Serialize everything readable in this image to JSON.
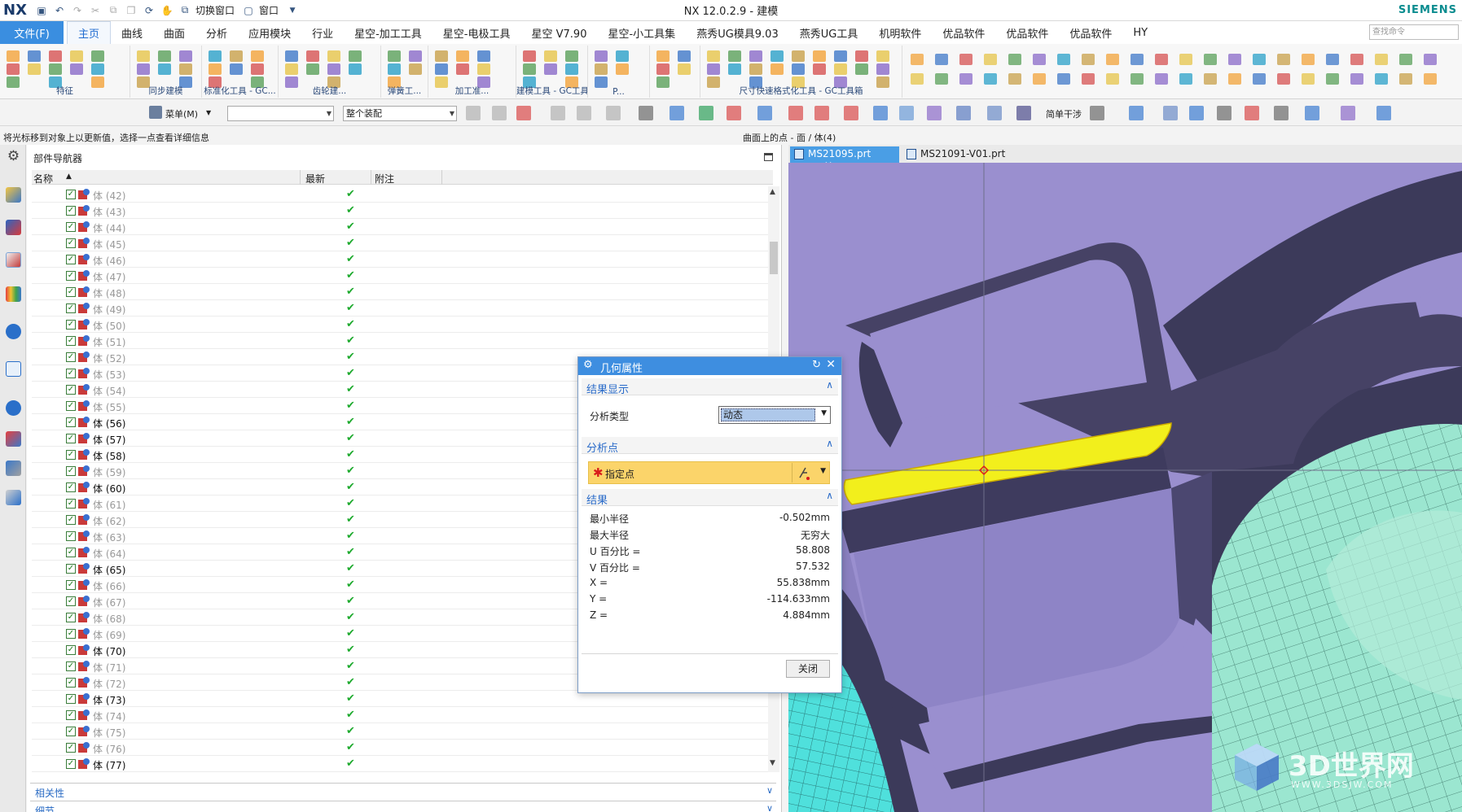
{
  "titlebar": {
    "logo": "NX",
    "switch_window": "切换窗口",
    "window_menu": "窗口",
    "title": "NX 12.0.2.9 - 建模",
    "brand": "SIEMENS"
  },
  "ribbon": {
    "file_tab": "文件(F)",
    "tabs": [
      "主页",
      "曲线",
      "曲面",
      "分析",
      "应用模块",
      "行业",
      "星空-加工工具",
      "星空-电极工具",
      "星空 V7.90",
      "星空-小工具集",
      "燕秀UG模具9.03",
      "燕秀UG工具",
      "机明软件",
      "优品软件",
      "优品软件",
      "优品软件",
      "HY"
    ],
    "active_tab": "主页",
    "search_placeholder": "查找命令",
    "groups": [
      "特征",
      "同步建模",
      "标准化工具 - GC...",
      "齿轮建...",
      "弹簧工...",
      "加工准...",
      "建模工具 - GC工具...",
      "P...",
      "尺寸快速格式化工具 - GC工具箱"
    ]
  },
  "toolbar2": {
    "menu_label": "菜单(M)",
    "filter_value": "",
    "assembly_value": "整个装配",
    "simple_interference": "简单干涉"
  },
  "status": {
    "left": "将光标移到对象上以更新值，选择一点查看详细信息",
    "right": "曲面上的点 - 面 / 体(4)"
  },
  "navigator": {
    "title": "部件导航器",
    "columns": [
      "名称",
      "最新",
      "附注"
    ],
    "rows": [
      {
        "name": "体 (42)",
        "active": false
      },
      {
        "name": "体 (43)",
        "active": false
      },
      {
        "name": "体 (44)",
        "active": false
      },
      {
        "name": "体 (45)",
        "active": false
      },
      {
        "name": "体 (46)",
        "active": false
      },
      {
        "name": "体 (47)",
        "active": false
      },
      {
        "name": "体 (48)",
        "active": false
      },
      {
        "name": "体 (49)",
        "active": false
      },
      {
        "name": "体 (50)",
        "active": false
      },
      {
        "name": "体 (51)",
        "active": false
      },
      {
        "name": "体 (52)",
        "active": false
      },
      {
        "name": "体 (53)",
        "active": false
      },
      {
        "name": "体 (54)",
        "active": false
      },
      {
        "name": "体 (55)",
        "active": false
      },
      {
        "name": "体 (56)",
        "active": true
      },
      {
        "name": "体 (57)",
        "active": true
      },
      {
        "name": "体 (58)",
        "active": true
      },
      {
        "name": "体 (59)",
        "active": false
      },
      {
        "name": "体 (60)",
        "active": true
      },
      {
        "name": "体 (61)",
        "active": false
      },
      {
        "name": "体 (62)",
        "active": false
      },
      {
        "name": "体 (63)",
        "active": false
      },
      {
        "name": "体 (64)",
        "active": false
      },
      {
        "name": "体 (65)",
        "active": true
      },
      {
        "name": "体 (66)",
        "active": false
      },
      {
        "name": "体 (67)",
        "active": false
      },
      {
        "name": "体 (68)",
        "active": false
      },
      {
        "name": "体 (69)",
        "active": false
      },
      {
        "name": "体 (70)",
        "active": true
      },
      {
        "name": "体 (71)",
        "active": false
      },
      {
        "name": "体 (72)",
        "active": false
      },
      {
        "name": "体 (73)",
        "active": true
      },
      {
        "name": "体 (74)",
        "active": false
      },
      {
        "name": "体 (75)",
        "active": false
      },
      {
        "name": "体 (76)",
        "active": false
      },
      {
        "name": "体 (77)",
        "active": true
      }
    ],
    "panels": [
      "相关性",
      "细节"
    ]
  },
  "viewport": {
    "tabs": [
      "MS21095.prt",
      "MS21091-V01.prt"
    ],
    "active_tab": "MS21095.prt"
  },
  "dialog": {
    "title": "几何属性",
    "section_display": "结果显示",
    "analysis_type_label": "分析类型",
    "analysis_type_value": "动态",
    "section_point": "分析点",
    "specify_point": "指定点",
    "section_results": "结果",
    "results": [
      {
        "label": "最小半径",
        "value": "-0.502mm"
      },
      {
        "label": "最大半径",
        "value": "无穷大"
      },
      {
        "label": "U 百分比 =",
        "value": "58.808"
      },
      {
        "label": "V 百分比 =",
        "value": "57.532"
      },
      {
        "label": "X =",
        "value": "55.838mm"
      },
      {
        "label": "Y =",
        "value": "-114.633mm"
      },
      {
        "label": "Z =",
        "value": "4.884mm"
      }
    ],
    "close_label": "关闭"
  },
  "watermark": {
    "brand": "3D世界网",
    "url": "WWW.3DSJW.COM"
  },
  "colors": {
    "accent": "#3e8ee0",
    "highlight": "#fbd46a",
    "model_face": "#9a8fcf",
    "model_dark": "#3c3a5a",
    "selected_face": "#f2ef1c",
    "mesh": "#8fe0c8"
  }
}
